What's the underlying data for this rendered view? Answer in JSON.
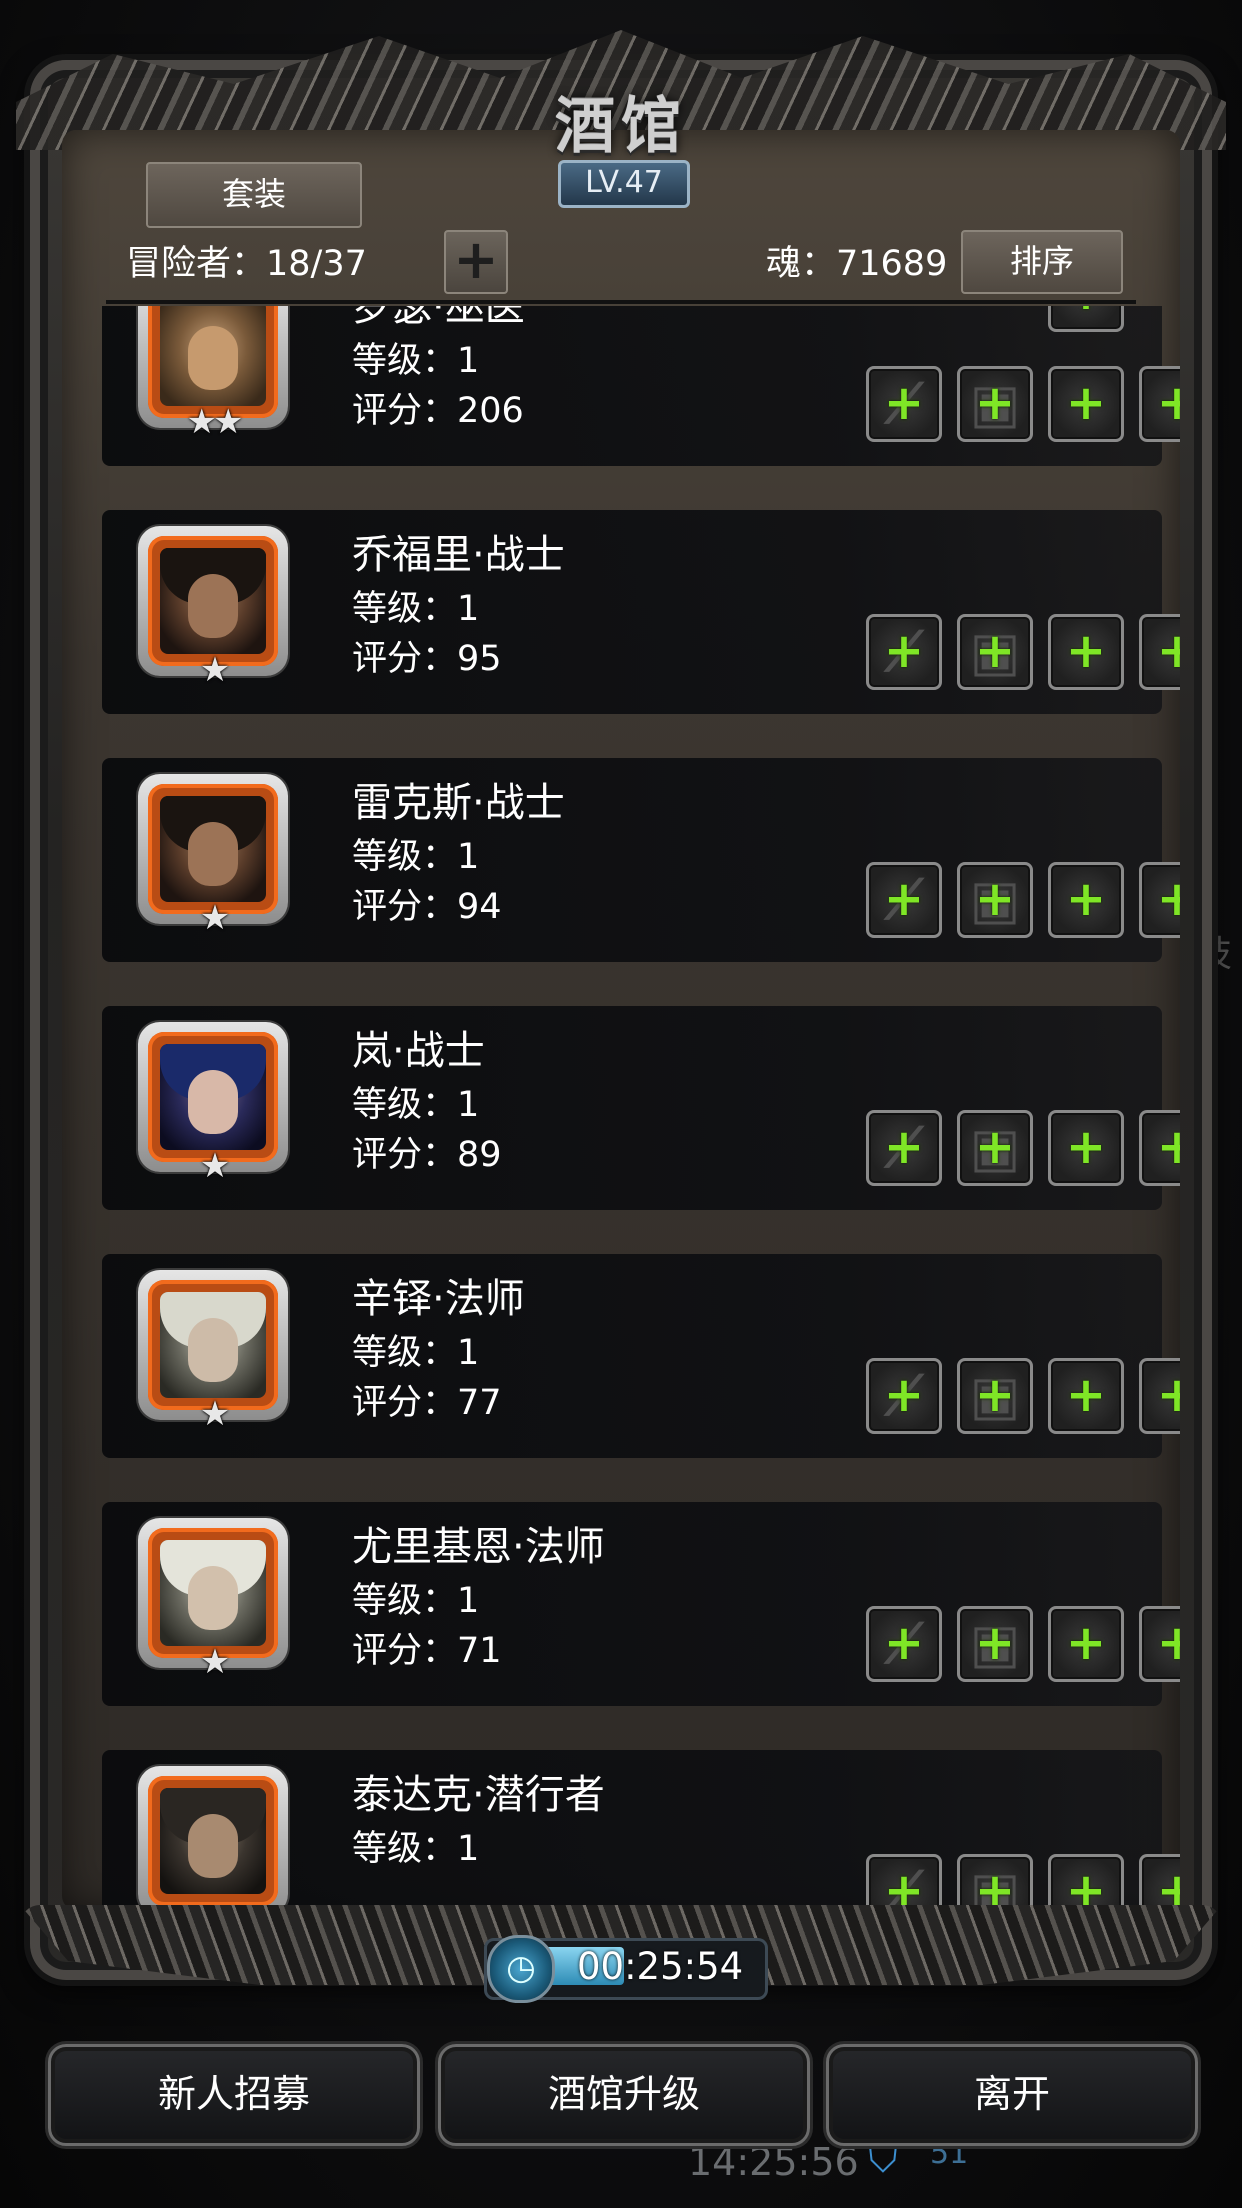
{
  "header": {
    "title": "酒馆",
    "level": "LV.47",
    "suit_button": "套装",
    "adventurers": "冒险者：18/37",
    "add_symbol": "+",
    "soul": "魂：71689",
    "sort_button": "排序"
  },
  "heroes": [
    {
      "name": "罗瑟·巫医",
      "level": "等级：1",
      "score": "评分：206",
      "stars": "★★"
    },
    {
      "name": "乔福里·战士",
      "level": "等级：1",
      "score": "评分：95",
      "stars": "★"
    },
    {
      "name": "雷克斯·战士",
      "level": "等级：1",
      "score": "评分：94",
      "stars": "★"
    },
    {
      "name": "岚·战士",
      "level": "等级：1",
      "score": "评分：89",
      "stars": "★"
    },
    {
      "name": "辛铎·法师",
      "level": "等级：1",
      "score": "评分：77",
      "stars": "★"
    },
    {
      "name": "尤里基恩·法师",
      "level": "等级：1",
      "score": "评分：71",
      "stars": "★"
    },
    {
      "name": "泰达克·潜行者",
      "level": "等级：1",
      "score": "",
      "stars": ""
    }
  ],
  "equipment_slot": {
    "plus": "+",
    "weapon_icon": "weapon-slot-icon",
    "armor_icon": "armor-slot-icon"
  },
  "timer": {
    "value": "00:25:54",
    "progress": 0.42
  },
  "buttons": {
    "recruit": "新人招募",
    "upgrade": "酒馆升级",
    "leave": "离开"
  },
  "background": {
    "clock": "14:25:56",
    "count": "51",
    "side_char": "技"
  },
  "colors": {
    "accent_green": "#7fe626",
    "portrait_orange": "#f26b1d"
  }
}
